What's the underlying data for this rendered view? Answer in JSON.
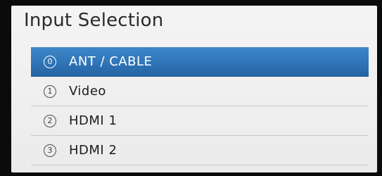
{
  "title": "Input Selection",
  "items": [
    {
      "number": "0",
      "label": "ANT / CABLE",
      "selected": true
    },
    {
      "number": "1",
      "label": "Video",
      "selected": false
    },
    {
      "number": "2",
      "label": "HDMI 1",
      "selected": false
    },
    {
      "number": "3",
      "label": "HDMI 2",
      "selected": false
    }
  ],
  "colors": {
    "highlight": "#2f74b6",
    "panel_bg": "#efefef",
    "frame": "#0b0b0b"
  }
}
